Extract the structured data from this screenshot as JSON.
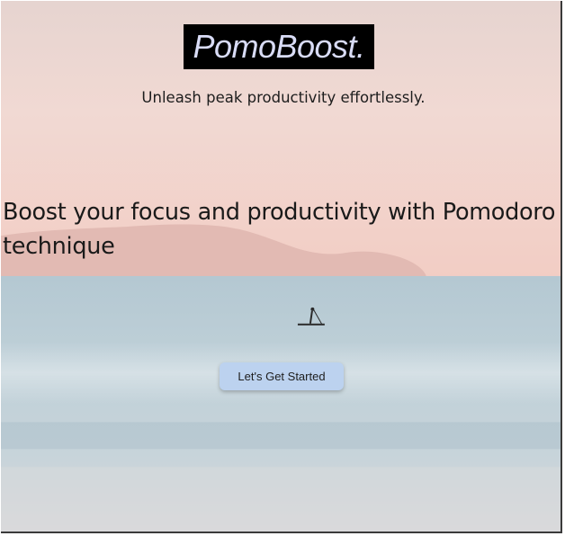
{
  "app": {
    "brand": "PomoBoost.",
    "tagline": "Unleash peak productivity effortlessly."
  },
  "hero": {
    "headline": "Boost your focus and productivity with Pomodoro technique",
    "cta_label": "Let's Get Started"
  },
  "colors": {
    "logo_background": "#000000",
    "logo_text": "#d9dcf6",
    "button_background": "#bcd2ef",
    "sky_top": "#e9d6d2",
    "sky_horizon": "#f0cfc7",
    "sea": "#b9cdd6"
  }
}
